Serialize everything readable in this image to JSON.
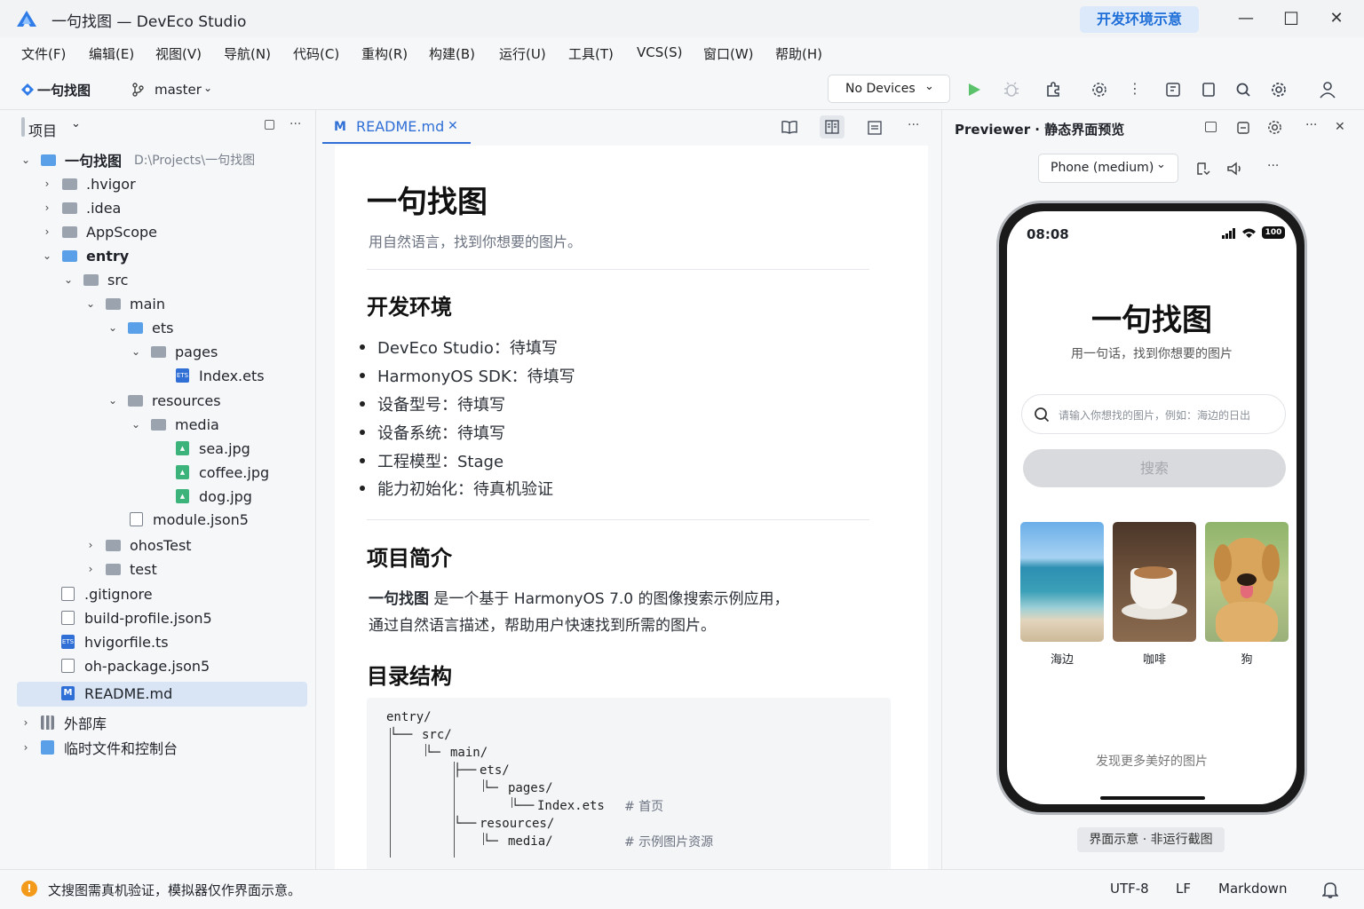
{
  "window": {
    "title": "一句找图 — DevEco Studio",
    "badge": "开发环境示意",
    "min": "—",
    "max": "☐",
    "close": "✕"
  },
  "menu": [
    "文件(F)",
    "编辑(E)",
    "视图(V)",
    "导航(N)",
    "代码(C)",
    "重构(R)",
    "构建(B)",
    "运行(U)",
    "工具(T)",
    "VCS(S)",
    "窗口(W)",
    "帮助(H)"
  ],
  "toolbar": {
    "project": "一句找图",
    "branch": "master",
    "device": "No Devices"
  },
  "project_panel": {
    "title": "项目",
    "root_name": "一句找图",
    "root_path": "D:\\Projects\\一句找图",
    "items": [
      {
        "label": ".hvigor"
      },
      {
        "label": ".idea"
      },
      {
        "label": "AppScope"
      },
      {
        "label": "entry"
      },
      {
        "label": "src"
      },
      {
        "label": "main"
      },
      {
        "label": "ets"
      },
      {
        "label": "pages"
      },
      {
        "label": "Index.ets"
      },
      {
        "label": "resources"
      },
      {
        "label": "media"
      },
      {
        "label": "sea.jpg"
      },
      {
        "label": "coffee.jpg"
      },
      {
        "label": "dog.jpg"
      },
      {
        "label": "module.json5"
      },
      {
        "label": "ohosTest"
      },
      {
        "label": "test"
      },
      {
        "label": ".gitignore"
      },
      {
        "label": "build-profile.json5"
      },
      {
        "label": "hvigorfile.ts"
      },
      {
        "label": "oh-package.json5"
      },
      {
        "label": "README.md"
      },
      {
        "label": "外部库"
      },
      {
        "label": "临时文件和控制台"
      }
    ]
  },
  "editor": {
    "tab": "README.md",
    "h1": "一句找图",
    "subtitle": "用自然语言，找到你想要的图片。",
    "h2_env": "开发环境",
    "env_items": [
      "DevEco Studio：待填写",
      "HarmonyOS SDK：待填写",
      "设备型号：待填写",
      "设备系统：待填写",
      "工程模型：Stage",
      "能力初始化：待真机验证"
    ],
    "h2_intro": "项目简介",
    "intro_bold": "一句找图",
    "intro_1": " 是一个基于 HarmonyOS 7.0 的图像搜索示例应用，",
    "intro_2": "通过自然语言描述，帮助用户快速找到所需的图片。",
    "h2_tree": "目录结构",
    "code": {
      "l1": "entry/",
      "l2": "src/",
      "l3": "main/",
      "l4": "ets/",
      "l5": "pages/",
      "l6": "Index.ets",
      "l6c": "# 首页",
      "l7": "resources/",
      "l8": "media/",
      "l8c": "# 示例图片资源"
    }
  },
  "previewer": {
    "title": "Previewer · 静态界面预览",
    "device": "Phone (medium)",
    "caption": "界面示意 · 非运行截图",
    "app": {
      "time": "08:08",
      "battery": "100",
      "title": "一句找图",
      "subtitle": "用一句话，找到你想要的图片",
      "search_placeholder": "请输入你想找的图片，例如：海边的日出",
      "search_button": "搜索",
      "images": [
        {
          "label": "海边"
        },
        {
          "label": "咖啡"
        },
        {
          "label": "狗"
        }
      ],
      "footer": "发现更多美好的图片"
    }
  },
  "status": {
    "message": "文搜图需真机验证，模拟器仅作界面示意。",
    "encoding": "UTF-8",
    "line_ending": "LF",
    "language": "Markdown"
  }
}
